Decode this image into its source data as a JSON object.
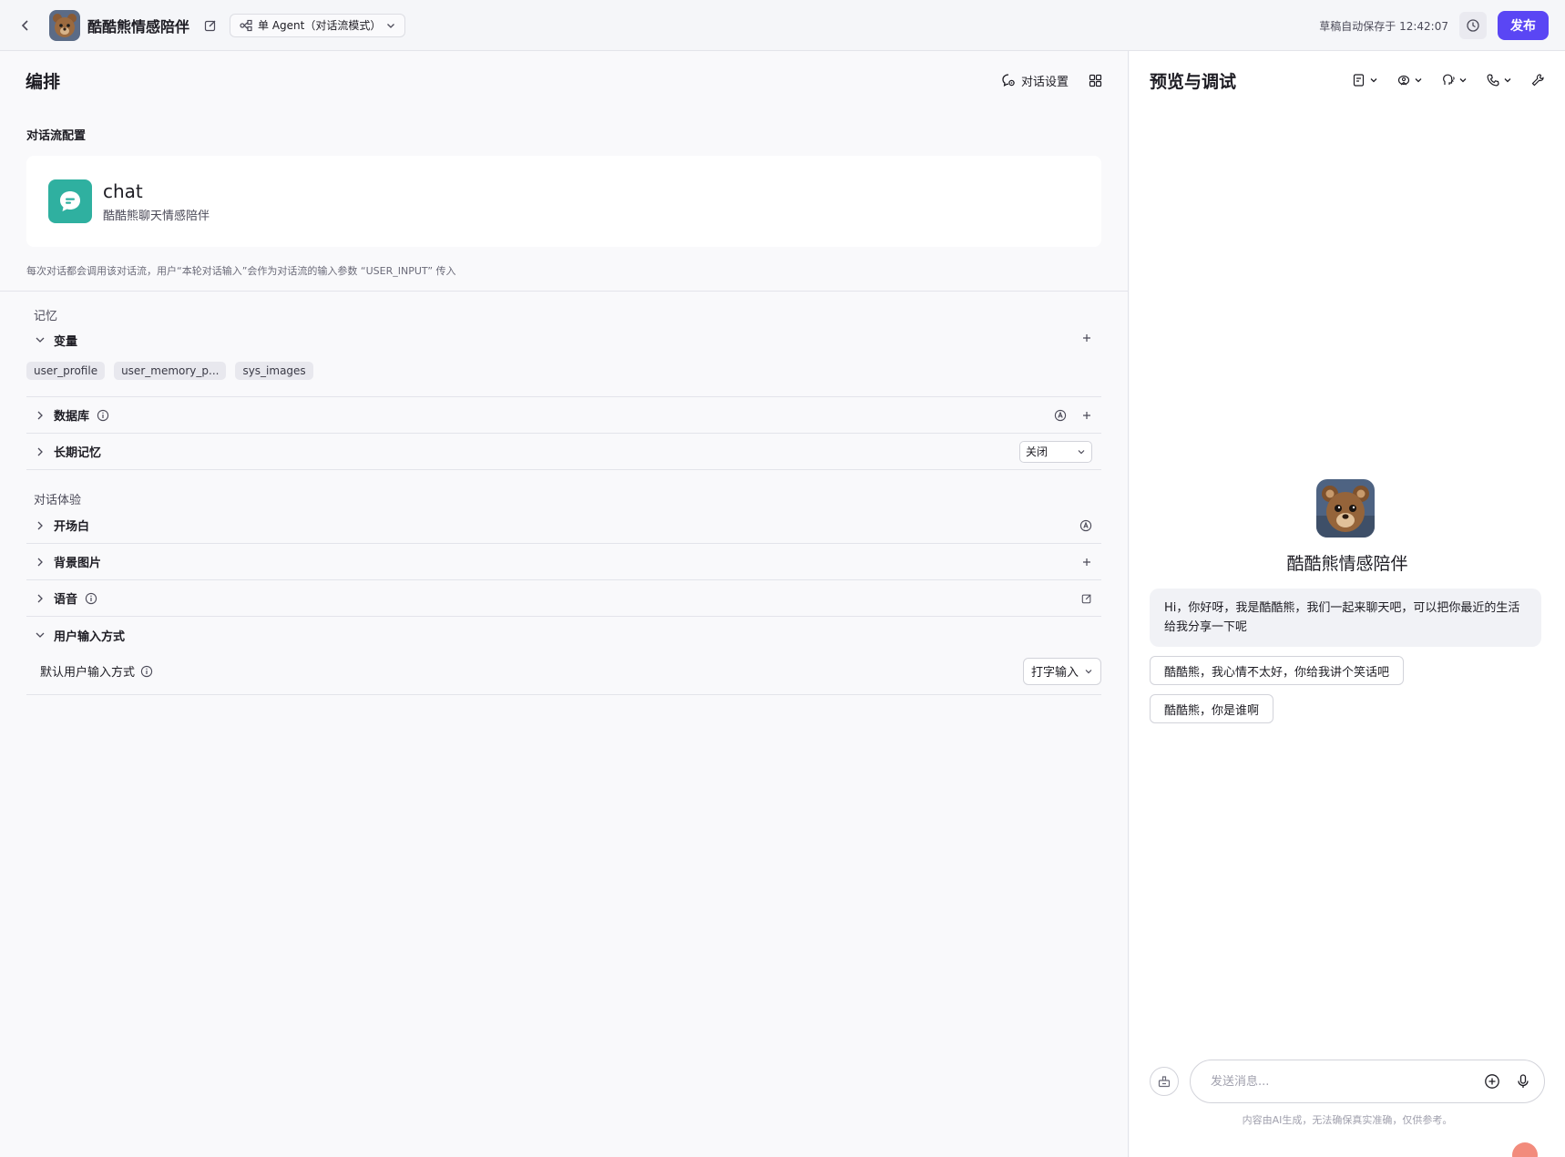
{
  "topbar": {
    "title": "酷酷熊情感陪伴",
    "mode_label": "单 Agent（对话流模式）",
    "autosave": "草稿自动保存于 12:42:07",
    "publish_label": "发布"
  },
  "left": {
    "title": "编排",
    "conv_settings_label": "对话设置",
    "flow_section_label": "对话流配置",
    "flow": {
      "name": "chat",
      "desc": "酷酷熊聊天情感陪伴"
    },
    "hint": "每次对话都会调用该对话流，用户“本轮对话输入”会作为对话流的输入参数 “USER_INPUT” 传入",
    "memory_label": "记忆",
    "variables_label": "变量",
    "variables": [
      "user_profile",
      "user_memory_p...",
      "sys_images"
    ],
    "database_label": "数据库",
    "long_memory_label": "长期记忆",
    "long_memory_value": "关闭",
    "experience_label": "对话体验",
    "opening_label": "开场白",
    "bg_image_label": "背景图片",
    "voice_label": "语音",
    "input_method_label": "用户输入方式",
    "default_input_label": "默认用户输入方式",
    "default_input_value": "打字输入"
  },
  "right": {
    "title": "预览与调试",
    "bot_name": "酷酷熊情感陪伴",
    "greeting": "Hi，你好呀，我是酷酷熊，我们一起来聊天吧，可以把你最近的生活给我分享一下呢",
    "suggestions": [
      "酷酷熊，我心情不太好，你给我讲个笑话吧",
      "酷酷熊，你是谁啊"
    ],
    "input_placeholder": "发送消息...",
    "disclaimer": "内容由AI生成，无法确保真实准确，仅供参考。"
  },
  "colors": {
    "accent": "#5a46f4",
    "flow_icon": "#2fb0a0"
  }
}
